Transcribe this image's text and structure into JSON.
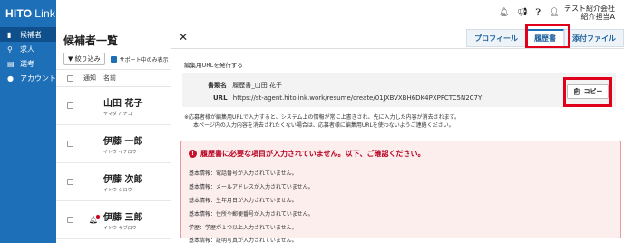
{
  "nav": {
    "logo_bold": "HITO",
    "logo_light": "Link",
    "items": [
      {
        "label": "候補者",
        "icon": "document-icon",
        "active": true
      },
      {
        "label": "求人",
        "icon": "search-icon",
        "active": false
      },
      {
        "label": "選考",
        "icon": "clipboard-icon",
        "active": false
      },
      {
        "label": "アカウント",
        "icon": "person-icon",
        "active": false
      }
    ]
  },
  "header": {
    "user_company": "テスト紹介会社",
    "user_name": "紹介担当A"
  },
  "list": {
    "title": "候補者一覧",
    "filter_label": "絞り込み",
    "support_label": "サポート中のみ表示",
    "col_notify": "通知",
    "col_name": "名前",
    "rows": [
      {
        "name": "山田 花子",
        "kana": "ヤマダ ハナコ",
        "bell": false
      },
      {
        "name": "伊藤 一郎",
        "kana": "イトウ イチロウ",
        "bell": false
      },
      {
        "name": "伊藤 次郎",
        "kana": "イトウ ジロウ",
        "bell": false
      },
      {
        "name": "伊藤 三郎",
        "kana": "イトウ サブロウ",
        "bell": true
      }
    ]
  },
  "detail": {
    "close": "✕",
    "tabs": [
      "プロフィール",
      "履歴書",
      "添付ファイル"
    ],
    "section_label": "編集用URLを発行する",
    "doc_label": "書類名",
    "doc_name": "履歴書_山田 花子",
    "url_label": "URL",
    "url_value": "https://st-agent.hitolink.work/resume/create/01JXBVXBH6DK4PXPFCTC5N2C7Y",
    "copy_label": "コピー",
    "note1": "※応募者様が編集用URLで入力すると、システム上の情報が常に上書きされ、先に入力した内容が消去されます。",
    "note2": "本ページ内の入力内容を消去されたくない場合は、応募者様に編集用URLを使わないようご連絡ください。",
    "error_title": "履歴書に必要な項目が入力されていません。以下、ご確認ください。",
    "errors": [
      "基本情報：電話番号が入力されていません。",
      "基本情報：メールアドレスが入力されていません。",
      "基本情報：生年月日が入力されていません。",
      "基本情報：住所や郵便番号が入力されていません。",
      "学歴：学歴が１つ以上入力されていません。",
      "基本情報：証明写真が入力されていません。"
    ]
  },
  "colors": {
    "nav_bg": "#1d6fb8",
    "highlight": "#e0001b",
    "error_bg": "#fdeeee"
  }
}
